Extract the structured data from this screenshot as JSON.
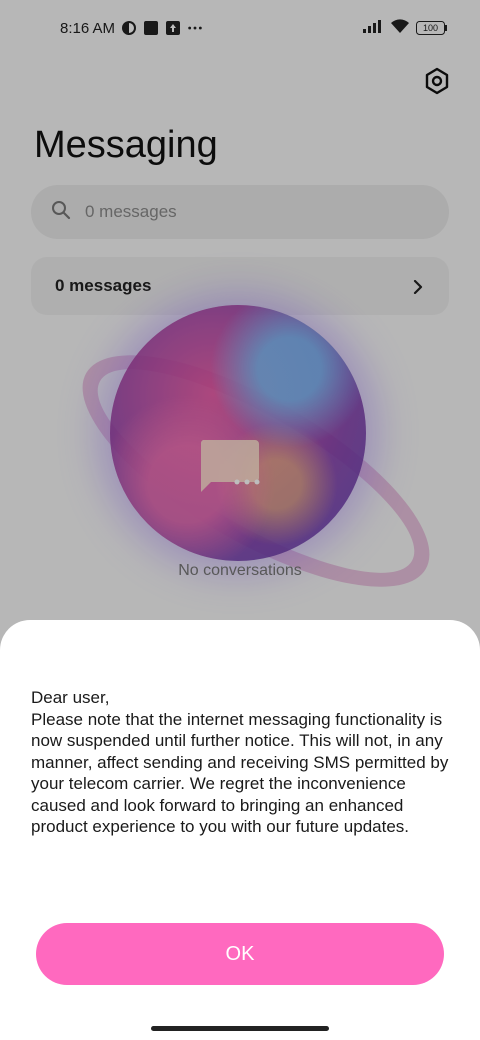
{
  "status_bar": {
    "time": "8:16 AM",
    "battery": "100",
    "icons": [
      "vpn-icon",
      "notification-square-icon",
      "upload-icon",
      "more-dots-icon",
      "signal-icon",
      "wifi-icon",
      "battery-icon"
    ]
  },
  "header": {
    "title": "Messaging",
    "settings_icon": "settings-hex-icon"
  },
  "search": {
    "placeholder": "0 messages"
  },
  "summary_row": {
    "label": "0 messages"
  },
  "empty_state": {
    "text": "No conversations"
  },
  "dialog": {
    "greeting": "Dear user,",
    "body": "Please note that the internet messaging functionality is now suspended until further notice. This will not, in any manner, affect sending and receiving SMS permitted by your telecom carrier. We regret the inconvenience caused and look forward to bringing an enhanced product experience to you with our future updates.",
    "ok_label": "OK"
  },
  "colors": {
    "accent": "#ff69bf"
  }
}
